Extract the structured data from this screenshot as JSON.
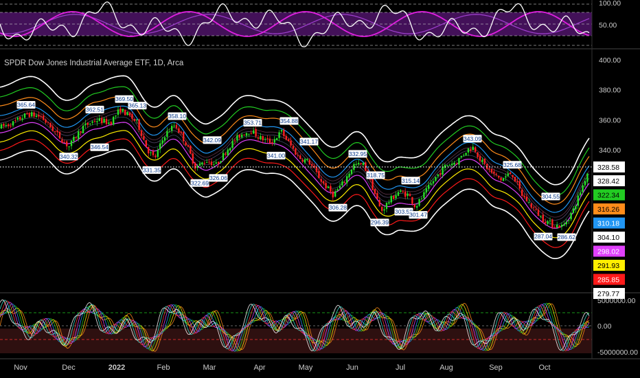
{
  "chart_data": {
    "type": "candlestick",
    "title": "SPDR Dow Jones Industrial Average ETF, 1D, Arca",
    "x_axis": {
      "ticks": [
        "Nov",
        "Dec",
        "2022",
        "Feb",
        "Mar",
        "Apr",
        "May",
        "Jun",
        "Jul",
        "Aug",
        "Sep",
        "Oct"
      ]
    },
    "main_panel": {
      "y_ticks": [
        "400.00",
        "380.00",
        "360.00",
        "340.00"
      ],
      "ylim": [
        270,
        400
      ],
      "last_price": 328.58,
      "band_values": [
        {
          "value": "328.42",
          "color": "#ffffff"
        },
        {
          "value": "322.34",
          "color": "#22cc22"
        },
        {
          "value": "316.26",
          "color": "#ff8c1a"
        },
        {
          "value": "310.18",
          "color": "#2196f3"
        },
        {
          "value": "304.10",
          "color": "#ffffff"
        },
        {
          "value": "298.02",
          "color": "#e040fb"
        },
        {
          "value": "291.93",
          "color": "#ffee00"
        },
        {
          "value": "285.85",
          "color": "#ff1a1a"
        },
        {
          "value": "279.77",
          "color": "#ffffff"
        }
      ],
      "price_labels": [
        {
          "text": "365.64",
          "value": 365.64,
          "pos": "above"
        },
        {
          "text": "340.32",
          "value": 340.32,
          "pos": "below"
        },
        {
          "text": "362.51",
          "value": 362.51,
          "pos": "above"
        },
        {
          "text": "346.54",
          "value": 346.54,
          "pos": "below"
        },
        {
          "text": "369.50",
          "value": 369.5,
          "pos": "above"
        },
        {
          "text": "365.13",
          "value": 365.13,
          "pos": "above"
        },
        {
          "text": "331.35",
          "value": 331.35,
          "pos": "below"
        },
        {
          "text": "358.10",
          "value": 358.1,
          "pos": "above"
        },
        {
          "text": "322.69",
          "value": 322.69,
          "pos": "below"
        },
        {
          "text": "342.09",
          "value": 342.09,
          "pos": "above"
        },
        {
          "text": "326.06",
          "value": 326.06,
          "pos": "below"
        },
        {
          "text": "353.71",
          "value": 353.71,
          "pos": "above"
        },
        {
          "text": "341.00",
          "value": 341.0,
          "pos": "below"
        },
        {
          "text": "354.88",
          "value": 354.88,
          "pos": "above"
        },
        {
          "text": "341.17",
          "value": 341.17,
          "pos": "above"
        },
        {
          "text": "306.28",
          "value": 306.28,
          "pos": "below"
        },
        {
          "text": "332.95",
          "value": 332.95,
          "pos": "above"
        },
        {
          "text": "296.39",
          "value": 296.39,
          "pos": "below"
        },
        {
          "text": "318.75",
          "value": 318.75,
          "pos": "above"
        },
        {
          "text": "315.14",
          "value": 315.14,
          "pos": "above"
        },
        {
          "text": "303.58",
          "value": 303.58,
          "pos": "below"
        },
        {
          "text": "301.47",
          "value": 301.47,
          "pos": "below"
        },
        {
          "text": "343.09",
          "value": 343.09,
          "pos": "above"
        },
        {
          "text": "325.68",
          "value": 325.68,
          "pos": "above"
        },
        {
          "text": "304.55",
          "value": 304.55,
          "pos": "above"
        },
        {
          "text": "287.04",
          "value": 287.04,
          "pos": "below"
        },
        {
          "text": "286.62",
          "value": 286.62,
          "pos": "below"
        }
      ]
    },
    "top_oscillator": {
      "y_ticks": [
        "100.00",
        "50.00"
      ]
    },
    "bottom_oscillator": {
      "y_ticks": [
        "5000000.00",
        "0.00",
        "-5000000.00"
      ]
    },
    "colors": {
      "up": "#26e026",
      "down": "#ff2020",
      "band_outer": "#ffffff",
      "band_green": "#22cc22",
      "band_orange": "#ff8c1a",
      "band_blue": "#2196f3",
      "band_magenta": "#e040fb",
      "band_yellow": "#ffee00",
      "band_red": "#ff1a1a",
      "osc_purple": "#7a1fa2",
      "osc_magenta": "#e020e0",
      "axis_text": "#cccccc"
    }
  }
}
